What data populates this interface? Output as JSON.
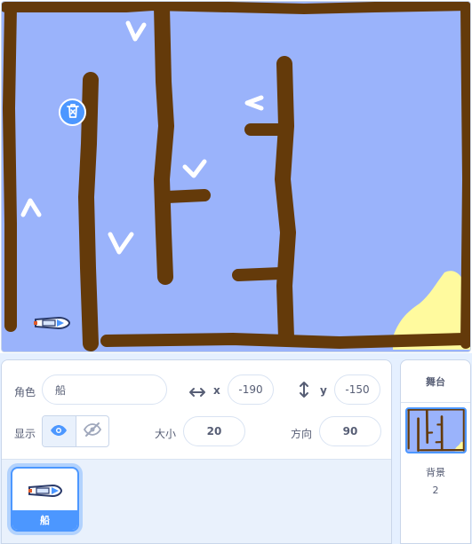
{
  "stage": {
    "background_color": "#9ab3fb",
    "wall_color": "#643a0a",
    "sand_color": "#fffa9e",
    "sprite_icon": "boat-icon"
  },
  "sprite_info": {
    "sprite_label": "角色",
    "sprite_name": "船",
    "x_label": "x",
    "x_value": "-190",
    "y_label": "y",
    "y_value": "-150",
    "show_label": "显示",
    "size_label": "大小",
    "size_value": "20",
    "direction_label": "方向",
    "direction_value": "90"
  },
  "sprite_list": [
    {
      "name": "船",
      "icon": "boat-icon",
      "selected": true
    }
  ],
  "stage_selector": {
    "title": "舞台",
    "backdrops_label": "背景",
    "backdrops_count": "2"
  },
  "colors": {
    "accent": "#4c97ff",
    "text": "#575e75"
  }
}
